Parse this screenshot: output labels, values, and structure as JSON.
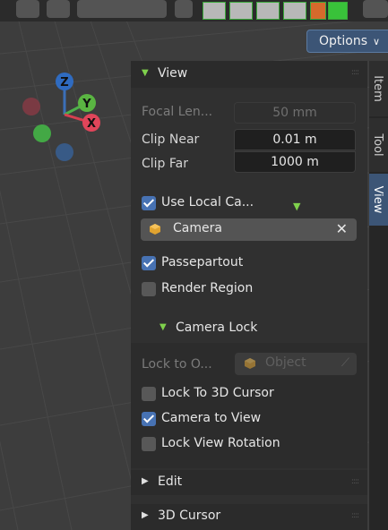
{
  "header": {
    "options_label": "Options"
  },
  "gizmo": {
    "z": "Z",
    "y": "Y",
    "x": "X"
  },
  "view_panel": {
    "title": "View",
    "focal_length_label": "Focal Len...",
    "focal_length_value": "50 mm",
    "clip_near_label": "Clip Near",
    "clip_near_value": "0.01 m",
    "clip_far_label": "Clip Far",
    "clip_far_value": "1000 m",
    "use_local_camera_label": "Use Local Ca...",
    "use_local_camera_checked": true,
    "camera_value": "Camera",
    "passepartout_label": "Passepartout",
    "passepartout_checked": true,
    "render_region_label": "Render Region",
    "render_region_checked": false
  },
  "camera_lock": {
    "title": "Camera Lock",
    "lock_to_object_label": "Lock to O...",
    "object_placeholder": "Object",
    "lock_to_cursor_label": "Lock To 3D Cursor",
    "lock_to_cursor_checked": false,
    "camera_to_view_label": "Camera to View",
    "camera_to_view_checked": true,
    "lock_view_rotation_label": "Lock View Rotation",
    "lock_view_rotation_checked": false
  },
  "collapsed_panels": {
    "edit": "Edit",
    "cursor": "3D Cursor"
  },
  "tabs": {
    "item": "Item",
    "tool": "Tool",
    "view": "View"
  },
  "colors": {
    "accent": "#4772b3",
    "tab_active": "#3c5576",
    "triangle_green": "#7fd14c"
  }
}
